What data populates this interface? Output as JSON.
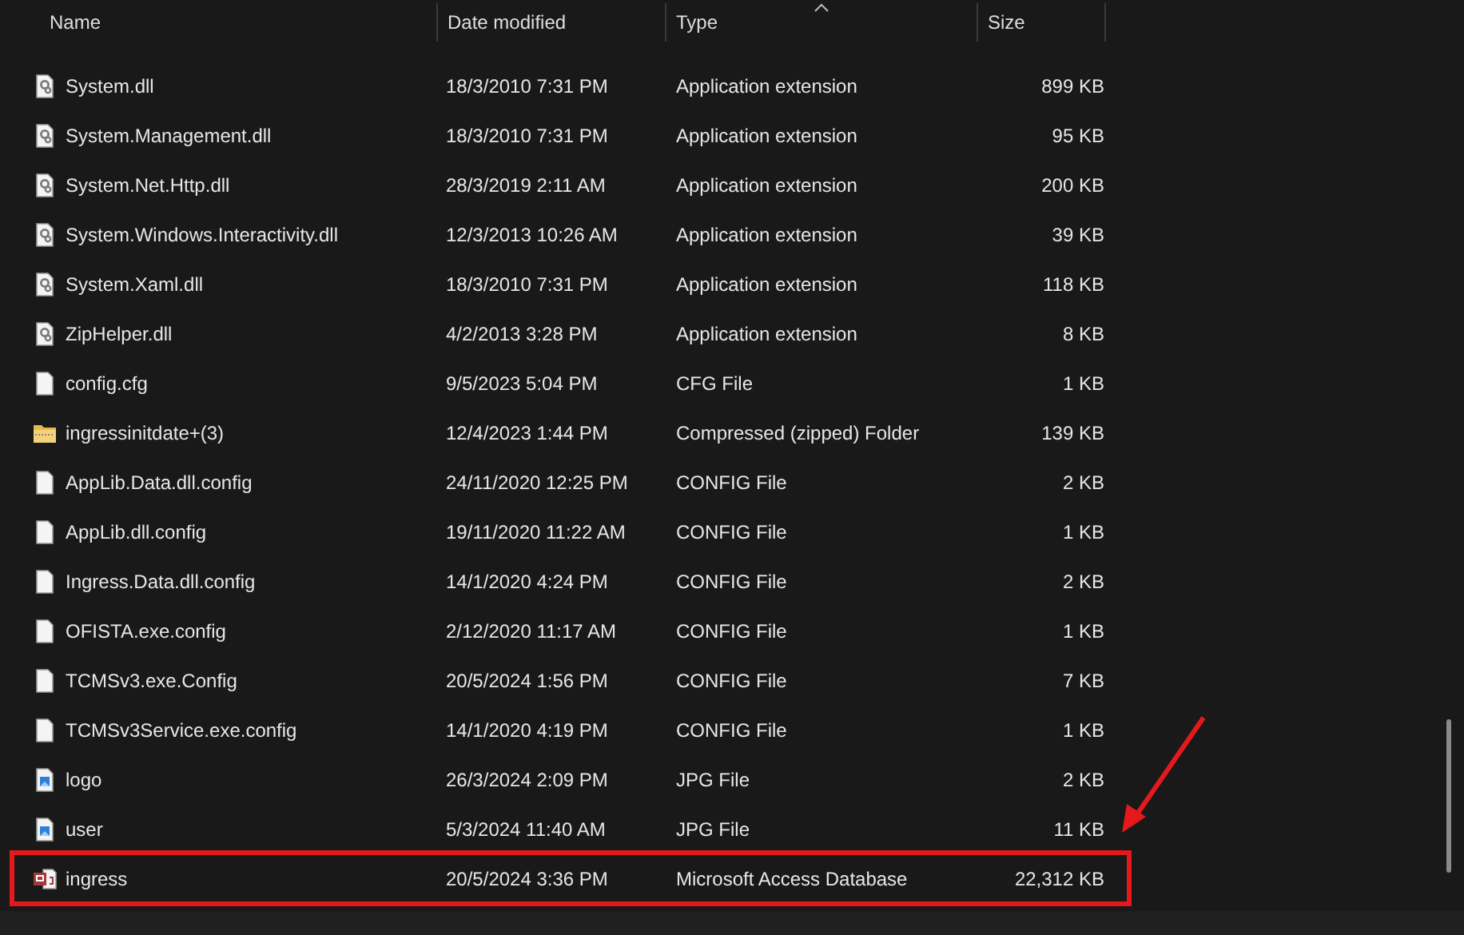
{
  "columns": [
    {
      "label": "Name"
    },
    {
      "label": "Date modified"
    },
    {
      "label": "Type",
      "sorted": true
    },
    {
      "label": "Size"
    }
  ],
  "rows": [
    {
      "name": "System.dll",
      "date": "18/3/2010 7:31 PM",
      "type": "Application extension",
      "size": "899 KB",
      "kind": "dll",
      "highlighted": false
    },
    {
      "name": "System.Management.dll",
      "date": "18/3/2010 7:31 PM",
      "type": "Application extension",
      "size": "95 KB",
      "kind": "dll",
      "highlighted": false
    },
    {
      "name": "System.Net.Http.dll",
      "date": "28/3/2019 2:11 AM",
      "type": "Application extension",
      "size": "200 KB",
      "kind": "dll",
      "highlighted": false
    },
    {
      "name": "System.Windows.Interactivity.dll",
      "date": "12/3/2013 10:26 AM",
      "type": "Application extension",
      "size": "39 KB",
      "kind": "dll",
      "highlighted": false
    },
    {
      "name": "System.Xaml.dll",
      "date": "18/3/2010 7:31 PM",
      "type": "Application extension",
      "size": "118 KB",
      "kind": "dll",
      "highlighted": false
    },
    {
      "name": "ZipHelper.dll",
      "date": "4/2/2013 3:28 PM",
      "type": "Application extension",
      "size": "8 KB",
      "kind": "dll",
      "highlighted": false
    },
    {
      "name": "config.cfg",
      "date": "9/5/2023 5:04 PM",
      "type": "CFG File",
      "size": "1 KB",
      "kind": "file",
      "highlighted": false
    },
    {
      "name": "ingressinitdate+(3)",
      "date": "12/4/2023 1:44 PM",
      "type": "Compressed (zipped) Folder",
      "size": "139 KB",
      "kind": "zip",
      "highlighted": false
    },
    {
      "name": "AppLib.Data.dll.config",
      "date": "24/11/2020 12:25 PM",
      "type": "CONFIG File",
      "size": "2 KB",
      "kind": "file",
      "highlighted": false
    },
    {
      "name": "AppLib.dll.config",
      "date": "19/11/2020 11:22 AM",
      "type": "CONFIG File",
      "size": "1 KB",
      "kind": "file",
      "highlighted": false
    },
    {
      "name": "Ingress.Data.dll.config",
      "date": "14/1/2020 4:24 PM",
      "type": "CONFIG File",
      "size": "2 KB",
      "kind": "file",
      "highlighted": false
    },
    {
      "name": "OFISTA.exe.config",
      "date": "2/12/2020 11:17 AM",
      "type": "CONFIG File",
      "size": "1 KB",
      "kind": "file",
      "highlighted": false
    },
    {
      "name": "TCMSv3.exe.Config",
      "date": "20/5/2024 1:56 PM",
      "type": "CONFIG File",
      "size": "7 KB",
      "kind": "file",
      "highlighted": false
    },
    {
      "name": "TCMSv3Service.exe.config",
      "date": "14/1/2020 4:19 PM",
      "type": "CONFIG File",
      "size": "1 KB",
      "kind": "file",
      "highlighted": false
    },
    {
      "name": "logo",
      "date": "26/3/2024 2:09 PM",
      "type": "JPG File",
      "size": "2 KB",
      "kind": "image",
      "highlighted": false
    },
    {
      "name": "user",
      "date": "5/3/2024 11:40 AM",
      "type": "JPG File",
      "size": "11 KB",
      "kind": "image",
      "highlighted": false
    },
    {
      "name": "ingress",
      "date": "20/5/2024 3:36 PM",
      "type": "Microsoft Access Database",
      "size": "22,312 KB",
      "kind": "access",
      "highlighted": true
    }
  ]
}
